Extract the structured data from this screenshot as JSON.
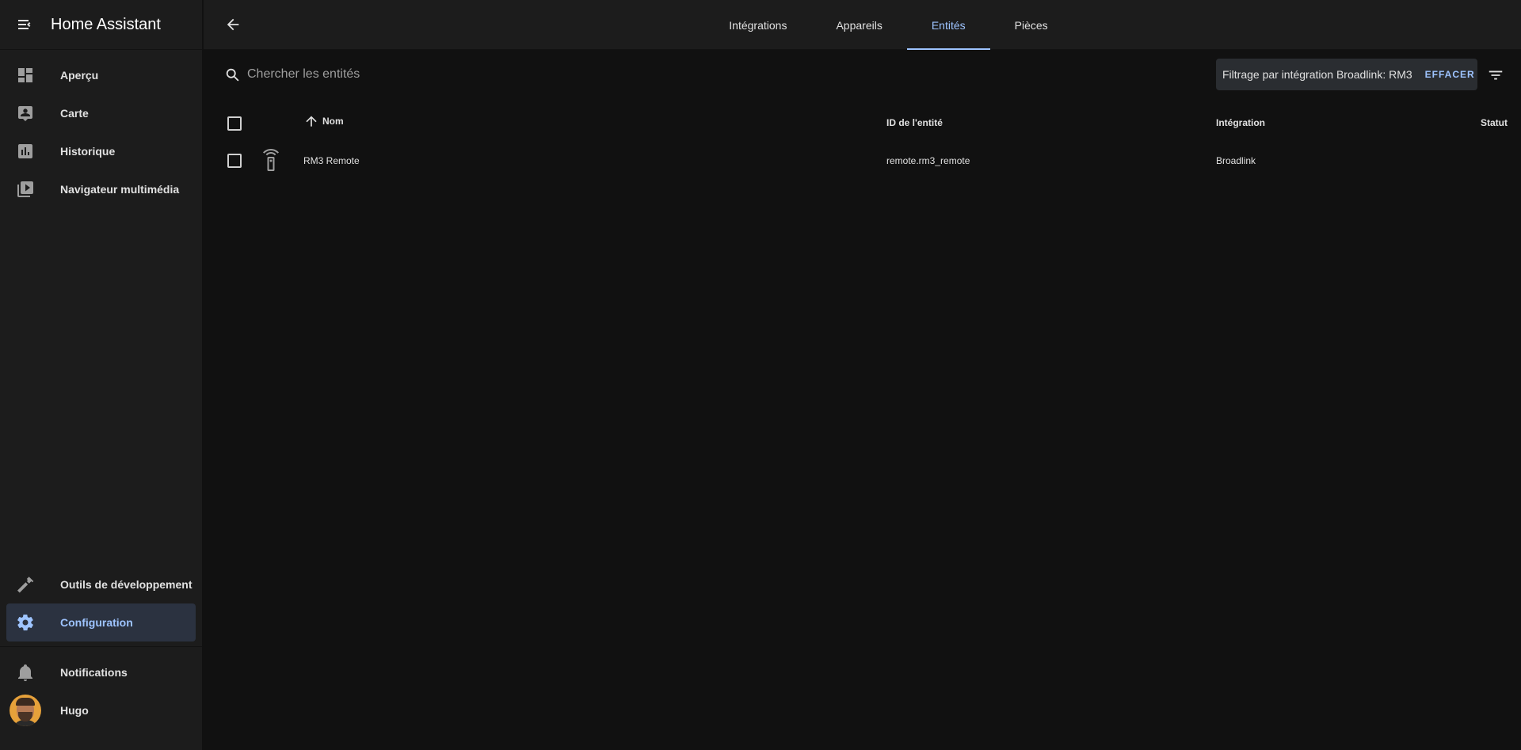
{
  "sidebar": {
    "title": "Home Assistant",
    "items": [
      {
        "label": "Aperçu",
        "icon": "dashboard-icon"
      },
      {
        "label": "Carte",
        "icon": "map-account-icon"
      },
      {
        "label": "Historique",
        "icon": "chart-box-icon"
      },
      {
        "label": "Navigateur multimédia",
        "icon": "play-box-multiple-icon"
      }
    ],
    "bottom_items": [
      {
        "label": "Outils de développement",
        "icon": "hammer-icon"
      },
      {
        "label": "Configuration",
        "icon": "cog-icon",
        "active": true
      }
    ],
    "notifications_label": "Notifications",
    "user_name": "Hugo"
  },
  "topbar": {
    "tabs": [
      "Intégrations",
      "Appareils",
      "Entités",
      "Pièces"
    ],
    "active_tab": "Entités"
  },
  "search": {
    "placeholder": "Chercher les entités"
  },
  "filter": {
    "text": "Filtrage par intégration Broadlink: RM3",
    "clear_label": "EFFACER"
  },
  "table": {
    "columns": {
      "name": "Nom",
      "entity_id": "ID de l'entité",
      "integration": "Intégration",
      "status": "Statut"
    },
    "rows": [
      {
        "name": "RM3 Remote",
        "entity_id": "remote.rm3_remote",
        "integration": "Broadlink",
        "icon": "remote-icon"
      }
    ]
  },
  "colors": {
    "accent": "#9ec4ff",
    "sidebar_bg": "#1c1c1c",
    "main_bg": "#111111"
  }
}
